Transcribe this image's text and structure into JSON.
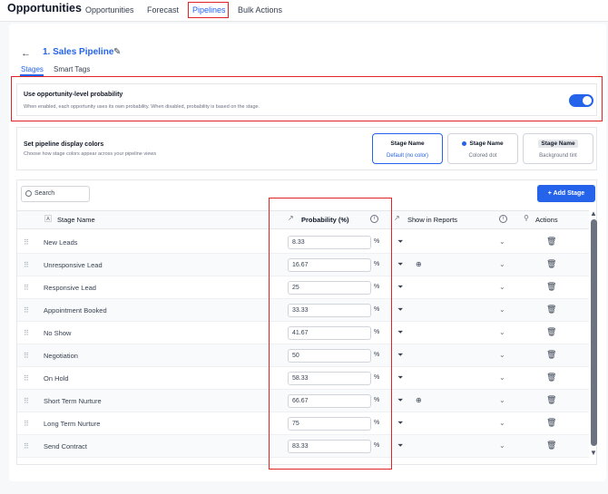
{
  "topnav": {
    "brand": "Opportunities",
    "tabs": [
      {
        "label": "Opportunities"
      },
      {
        "label": "Forecast"
      },
      {
        "label": "Pipelines"
      },
      {
        "label": "Bulk Actions"
      }
    ],
    "active_tab": "Pipelines"
  },
  "page": {
    "title": "1. Sales Pipeline",
    "subtabs": [
      {
        "label": "Stages"
      },
      {
        "label": "Smart Tags"
      }
    ]
  },
  "probability_setting": {
    "title": "Use opportunity-level probability",
    "description": "When enabled, each opportunity uses its own probability. When disabled, probability is based on the stage.",
    "enabled": true
  },
  "display_colors": {
    "title": "Set pipeline display colors",
    "description": "Choose how stage colors appear across your pipeline views",
    "options": [
      {
        "name": "Stage Name",
        "desc": "Default (no color)"
      },
      {
        "name": "Stage Name",
        "desc": "Colored dot"
      },
      {
        "name": "Stage Name",
        "desc": "Background tint"
      }
    ],
    "selected": "Default (no color)"
  },
  "table": {
    "search_placeholder": "Search",
    "add_button": "Add Stage",
    "columns": {
      "stage_name": "Stage Name",
      "probability": "Probability (%)",
      "show_in_reports": "Show in Reports",
      "actions": "Actions"
    },
    "pct_symbol": "%",
    "rows": [
      {
        "name": "New Leads",
        "probability": "8.33",
        "report_globe": false
      },
      {
        "name": "Unresponsive Lead",
        "probability": "16.67",
        "report_globe": true
      },
      {
        "name": "Responsive Lead",
        "probability": "25",
        "report_globe": false
      },
      {
        "name": "Appointment Booked",
        "probability": "33.33",
        "report_globe": false
      },
      {
        "name": "No Show",
        "probability": "41.67",
        "report_globe": false
      },
      {
        "name": "Negotiation",
        "probability": "50",
        "report_globe": false
      },
      {
        "name": "On Hold",
        "probability": "58.33",
        "report_globe": false
      },
      {
        "name": "Short Term Nurture",
        "probability": "66.67",
        "report_globe": true
      },
      {
        "name": "Long Term Nurture",
        "probability": "75",
        "report_globe": false
      },
      {
        "name": "Send Contract",
        "probability": "83.33",
        "report_globe": false
      }
    ]
  },
  "colors": {
    "accent": "#2563eb",
    "highlight": "#e02424"
  },
  "icons": [
    "back-arrow-icon",
    "pencil-icon",
    "search-icon",
    "plus-icon",
    "text-icon",
    "trend-icon",
    "info-icon",
    "drag-handle-icon",
    "filter-icon",
    "globe-icon",
    "chevron-down-icon",
    "trash-icon"
  ]
}
